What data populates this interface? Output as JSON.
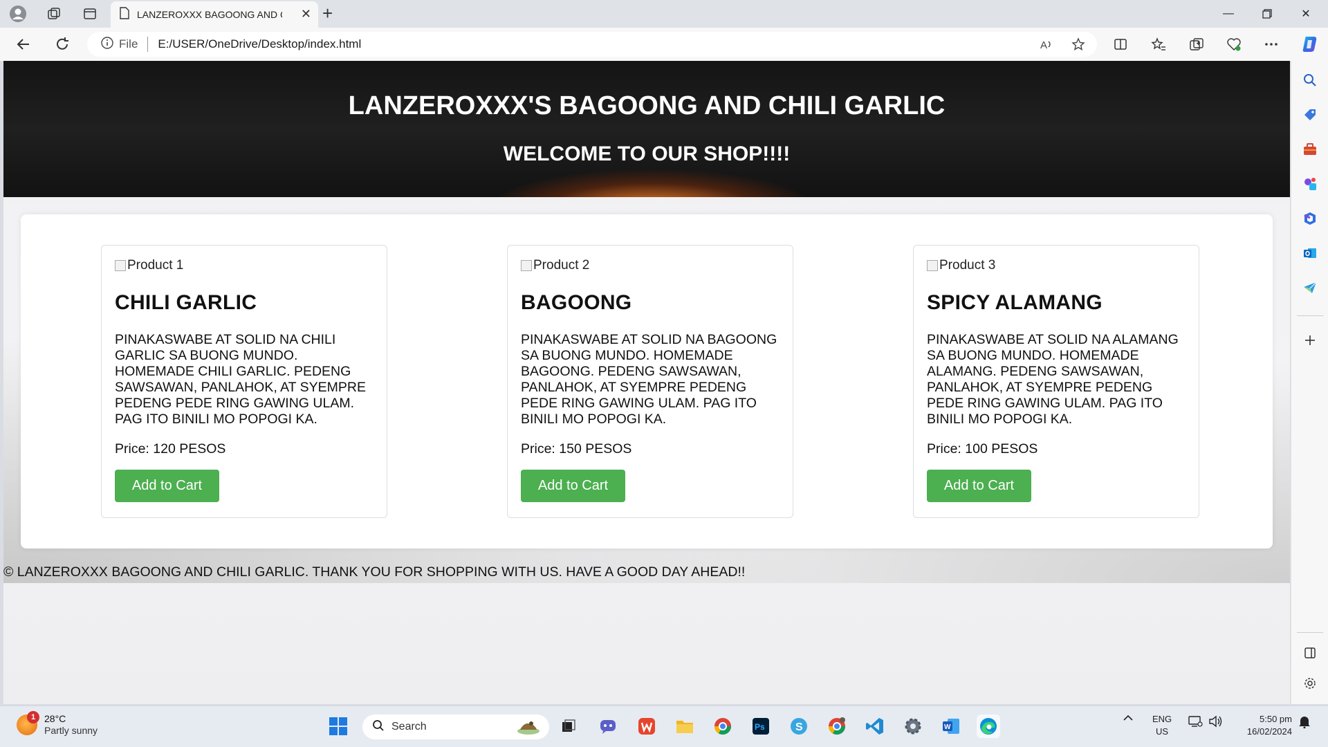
{
  "browser": {
    "tab_title": "LANZEROXXX BAGOONG AND CHILI GARLIC",
    "address_label": "File",
    "url": "E:/USER/OneDrive/Desktop/index.html"
  },
  "page": {
    "hero_title": "LANZEROXXX'S BAGOONG AND CHILI GARLIC",
    "hero_subtitle": "WELCOME TO OUR SHOP!!!!",
    "products": [
      {
        "image_alt": "Product 1",
        "name": "CHILI GARLIC",
        "description": "PINAKASWABE AT SOLID NA CHILI GARLIC SA BUONG MUNDO. HOMEMADE CHILI GARLIC. PEDENG SAWSAWAN, PANLAHOK, AT SYEMPRE PEDENG PEDE RING GAWING ULAM. PAG ITO BINILI MO POPOGI KA.",
        "price": "Price: 120 PESOS",
        "button": "Add to Cart"
      },
      {
        "image_alt": "Product 2",
        "name": "BAGOONG",
        "description": "PINAKASWABE AT SOLID NA BAGOONG SA BUONG MUNDO. HOMEMADE BAGOONG. PEDENG SAWSAWAN, PANLAHOK, AT SYEMPRE PEDENG PEDE RING GAWING ULAM. PAG ITO BINILI MO POPOGI KA.",
        "price": "Price: 150 PESOS",
        "button": "Add to Cart"
      },
      {
        "image_alt": "Product 3",
        "name": "SPICY ALAMANG",
        "description": "PINAKASWABE AT SOLID NA ALAMANG SA BUONG MUNDO. HOMEMADE ALAMANG. PEDENG SAWSAWAN, PANLAHOK, AT SYEMPRE PEDENG PEDE RING GAWING ULAM. PAG ITO BINILI MO POPOGI KA.",
        "price": "Price: 100 PESOS",
        "button": "Add to Cart"
      }
    ],
    "footer": "© LANZEROXXX BAGOONG AND CHILI GARLIC. THANK YOU FOR SHOPPING WITH US. HAVE A GOOD DAY AHEAD!!"
  },
  "taskbar": {
    "weather_temp": "28°C",
    "weather_desc": "Partly sunny",
    "weather_badge": "1",
    "search_label": "Search",
    "lang_top": "ENG",
    "lang_bottom": "US",
    "time": "5:50 pm",
    "date": "16/02/2024"
  },
  "colors": {
    "cart_button": "#4caf50",
    "hero_background": "#141414",
    "edge_accent": "#0078d4"
  }
}
